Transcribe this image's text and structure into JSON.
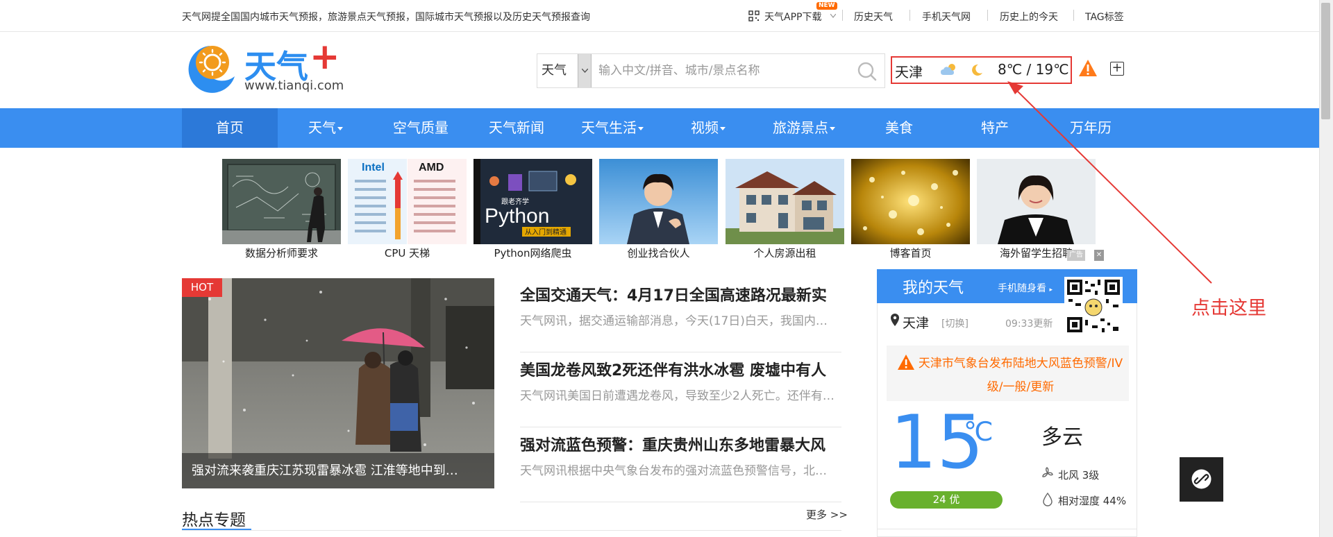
{
  "topbar": {
    "intro": "天气网提全国国内城市天气预报，旅游景点天气预报，国际城市天气预报以及历史天气预报查询",
    "app_download": "天气APP下载",
    "new_badge": "NEW",
    "links": [
      "历史天气",
      "手机天气网",
      "历史上的今天",
      "TAG标签"
    ]
  },
  "logo": {
    "brand": "天气",
    "plus": "+",
    "domain": "www.tianqi.com"
  },
  "search": {
    "type": "天气",
    "placeholder": "输入中文/拼音、城市/景点名称"
  },
  "current": {
    "city": "天津",
    "temp_range": "8℃ / 19℃",
    "day_icon": "cloud-sun-icon",
    "night_icon": "moon-icon"
  },
  "nav": {
    "items": [
      {
        "label": "首页",
        "active": true,
        "dropdown": false
      },
      {
        "label": "天气",
        "active": false,
        "dropdown": true
      },
      {
        "label": "空气质量",
        "active": false,
        "dropdown": false
      },
      {
        "label": "天气新闻",
        "active": false,
        "dropdown": false
      },
      {
        "label": "天气生活",
        "active": false,
        "dropdown": true
      },
      {
        "label": "视频",
        "active": false,
        "dropdown": true
      },
      {
        "label": "旅游景点",
        "active": false,
        "dropdown": true
      },
      {
        "label": "美食",
        "active": false,
        "dropdown": false
      },
      {
        "label": "特产",
        "active": false,
        "dropdown": false
      },
      {
        "label": "万年历",
        "active": false,
        "dropdown": false
      }
    ]
  },
  "ads": {
    "items": [
      {
        "caption": "数据分析师要求"
      },
      {
        "caption": "CPU 天梯",
        "image_text": [
          "Intel",
          "AMD"
        ]
      },
      {
        "caption": "Python网络爬虫",
        "image_text": [
          "Python",
          "跟老齐学",
          "从入门到精通"
        ]
      },
      {
        "caption": "创业找合伙人"
      },
      {
        "caption": "个人房源出租"
      },
      {
        "caption": "博客首页"
      },
      {
        "caption": "海外留学生招聘"
      }
    ],
    "ad_tag": "广告",
    "close": "✕"
  },
  "hero": {
    "badge": "HOT",
    "caption": "强对流来袭重庆江苏现雷暴冰雹 江淮等地中到…"
  },
  "news": [
    {
      "title": "全国交通天气：4月17日全国高速路况最新实",
      "summary": "天气网讯，据交通运输部消息，今天(17日)白天，我国内…"
    },
    {
      "title": "美国龙卷风致2死还伴有洪水冰雹 废墟中有人",
      "summary": "天气网讯美国日前遭遇龙卷风，导致至少2人死亡。还伴有…"
    },
    {
      "title": "强对流蓝色预警：重庆贵州山东多地雷暴大风",
      "summary": "天气网讯根据中央气象台发布的强对流蓝色预警信号，北…"
    }
  ],
  "hot_topics": {
    "title": "热点专题",
    "more": "更多 >>"
  },
  "my_weather": {
    "title": "我的天气",
    "mobile": "手机随身看",
    "city": "天津",
    "switch": "[切换]",
    "updated": "09:33更新",
    "alert": "天津市气象台发布陆地大风蓝色预警/IV级/一般/更新",
    "temp": "15",
    "unit": "℃",
    "condition": "多云",
    "aqi": "24 优",
    "wind": "北风 3级",
    "humidity": "相对湿度 44%"
  },
  "annotation": {
    "text": "点击这里"
  },
  "colors": {
    "brand_blue": "#3a8ef0",
    "alert_red": "#e53935",
    "warn_orange": "#ff6a00",
    "aqi_green": "#69b12d"
  }
}
